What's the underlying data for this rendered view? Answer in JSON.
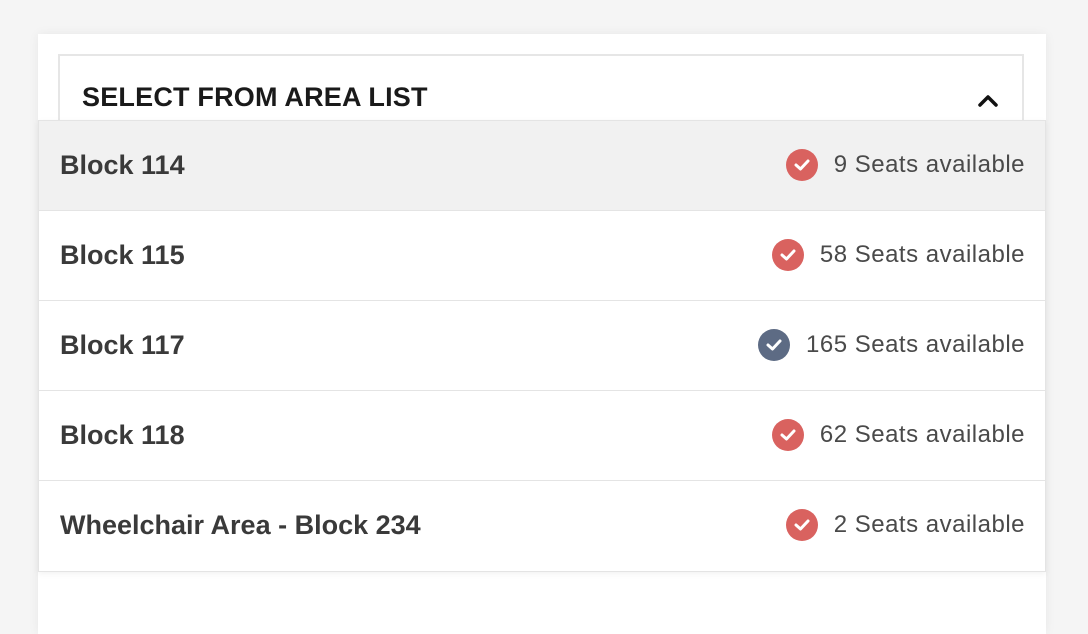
{
  "area_select": {
    "title": "SELECT FROM AREA LIST",
    "chevron_icon": "chevron-up-icon"
  },
  "status_colors": {
    "red": "#d9625f",
    "blue": "#5d6b84"
  },
  "areas": [
    {
      "label": "Block 114",
      "seats": "9 Seats available",
      "status": "red",
      "highlighted": true
    },
    {
      "label": "Block 115",
      "seats": "58 Seats available",
      "status": "red",
      "highlighted": false
    },
    {
      "label": "Block 117",
      "seats": "165 Seats available",
      "status": "blue",
      "highlighted": false
    },
    {
      "label": "Block 118",
      "seats": "62 Seats available",
      "status": "red",
      "highlighted": false
    },
    {
      "label": "Wheelchair Area - Block 234",
      "seats": "2 Seats available",
      "status": "red",
      "highlighted": false
    }
  ]
}
